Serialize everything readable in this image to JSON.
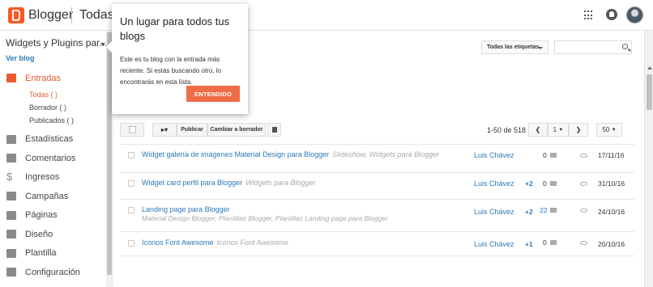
{
  "topbar": {
    "brand": "Blogger",
    "breadcrumb": "Todas las entradas"
  },
  "sidebar": {
    "blog_name": "Widgets y Plugins par...",
    "view_blog": "Ver blog",
    "posts_label": "Entradas",
    "sub_items": [
      {
        "label": "Todas ( )"
      },
      {
        "label": "Borrador ( )"
      },
      {
        "label": "Publicados ( )"
      }
    ],
    "items": [
      {
        "label": "Estadísticas",
        "icon": "stats-icon"
      },
      {
        "label": "Comentarios",
        "icon": "comments-icon"
      },
      {
        "label": "Ingresos",
        "icon": "dollar-icon"
      },
      {
        "label": "Campañas",
        "icon": "campaign-icon"
      },
      {
        "label": "Páginas",
        "icon": "pages-icon"
      },
      {
        "label": "Diseño",
        "icon": "layout-icon"
      },
      {
        "label": "Plantilla",
        "icon": "template-icon"
      },
      {
        "label": "Configuración",
        "icon": "settings-icon"
      }
    ],
    "accent": "#e75b31"
  },
  "popover": {
    "title": "Un lugar para todos tus blogs",
    "body": "Este es tu blog con la entrada más reciente. Si estás buscando otro, lo encontrarás en esta lista.",
    "button": "ENTENDIDO",
    "button_color": "#ef6c46"
  },
  "filters": {
    "labels_filter": "Todas las etiquetas",
    "search_placeholder": ""
  },
  "toolbar": {
    "publish": "Publicar",
    "revert": "Cambiar a borrador",
    "count": "1-50 de 518",
    "page": "1",
    "per_page": "50"
  },
  "posts": [
    {
      "title": "Widget galería de imágenes Material Design para Blogger",
      "labels": "Slideshow, Widgets para Blogger",
      "sub_labels": "",
      "author": "Luis Chávez",
      "plus": "",
      "comments": "0",
      "date": "17/11/16"
    },
    {
      "title": "Widget card perfil para Blogger",
      "labels": "Widgets para Blogger",
      "sub_labels": "",
      "author": "Luis Chávez",
      "plus": "+2",
      "comments": "0",
      "date": "31/10/16"
    },
    {
      "title": "Landing page para Blogger",
      "labels": "",
      "sub_labels": "Material Design Blogger, Plantillas Blogger, Plantillas Landing page para Blogger",
      "author": "Luis Chávez",
      "plus": "+2",
      "comments": "22",
      "date": "24/10/16"
    },
    {
      "title": "Iconos Font Awesome",
      "labels": "Iconos Font Awesome",
      "sub_labels": "",
      "author": "Luis Chávez",
      "plus": "+1",
      "comments": "0",
      "date": "20/10/16"
    }
  ]
}
